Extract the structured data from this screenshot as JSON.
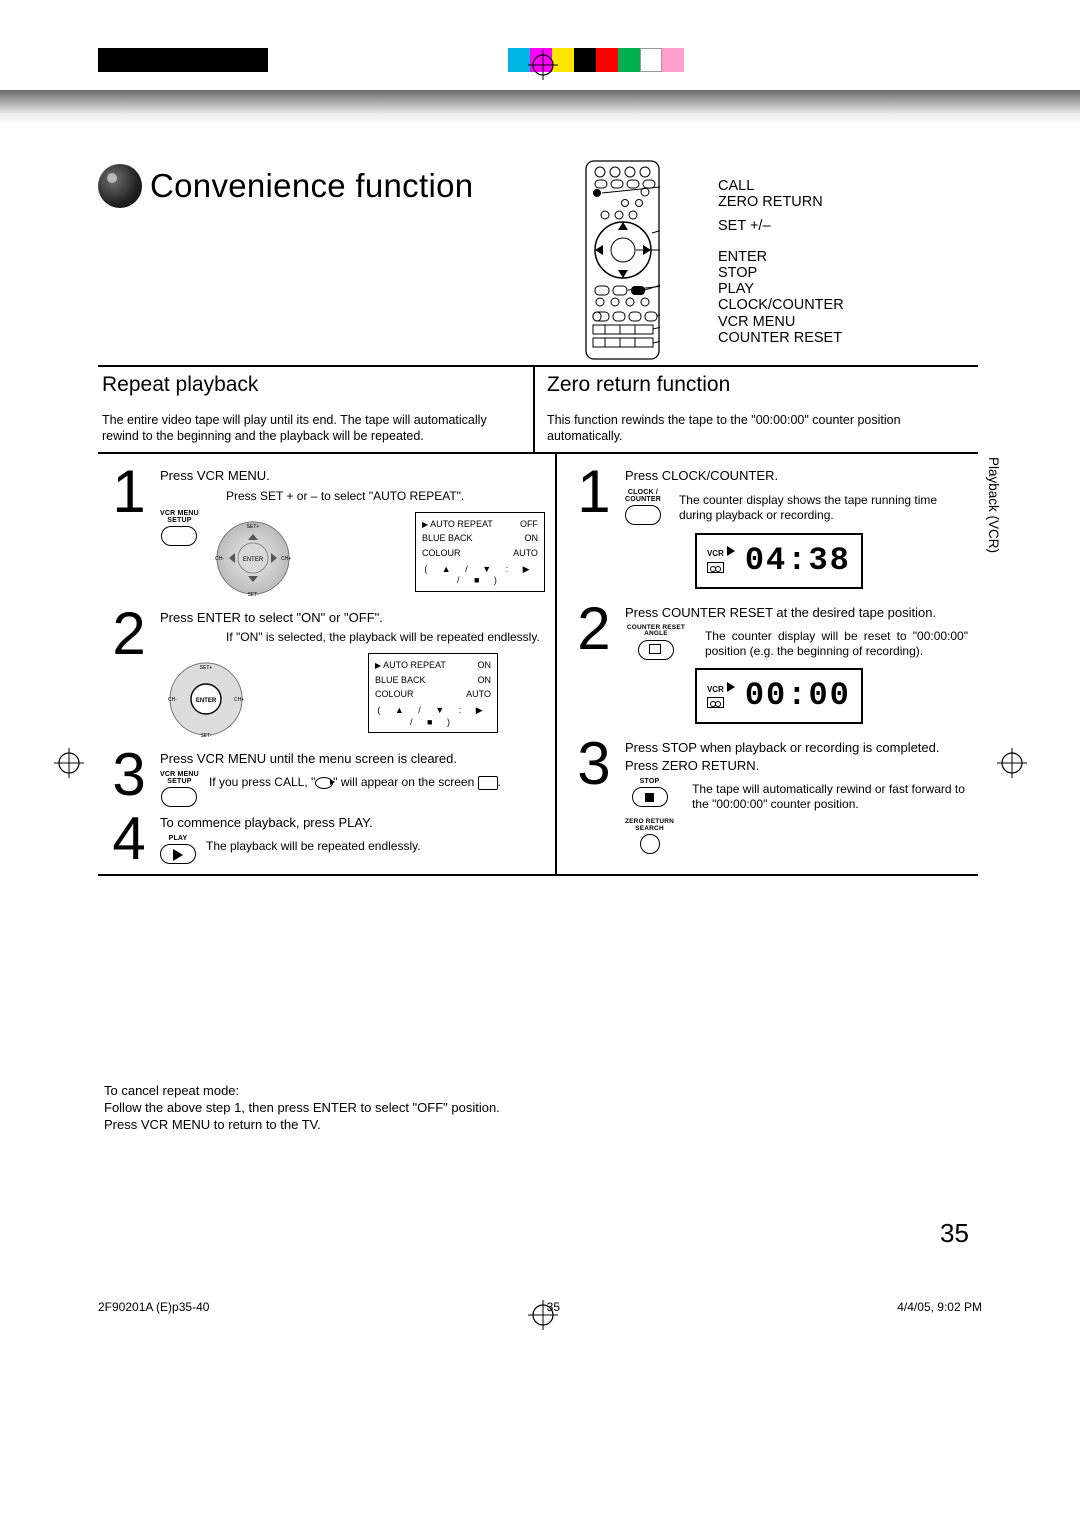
{
  "page": {
    "title": "Convenience function",
    "number": "35",
    "side_tab": "Playback (VCR)"
  },
  "colorbar": [
    "#00b5e2",
    "#ff00ff",
    "#ffe600",
    "#000000",
    "#ff0000",
    "#00b050",
    "#ffffff",
    "#ff9ecf"
  ],
  "remote_labels": [
    "CALL",
    "ZERO RETURN",
    "SET +/–",
    "ENTER",
    "STOP",
    "PLAY",
    "CLOCK/COUNTER",
    "VCR MENU",
    "COUNTER RESET"
  ],
  "left": {
    "heading": "Repeat playback",
    "intro": "The entire video tape will play until its end. The tape will automatically rewind to the beginning and the playback will be repeated.",
    "lcd_ctrls": "( ▲ / ▼ : ▶ / ■ )",
    "menu": {
      "rows": [
        {
          "label": "AUTO REPEAT",
          "value": "OFF",
          "sel": true
        },
        {
          "label": "BLUE BACK",
          "value": "ON"
        },
        {
          "label": "COLOUR",
          "value": "AUTO"
        }
      ]
    },
    "menu2": {
      "rows": [
        {
          "label": "AUTO REPEAT",
          "value": "ON",
          "sel": true
        },
        {
          "label": "BLUE BACK",
          "value": "ON"
        },
        {
          "label": "COLOUR",
          "value": "AUTO"
        }
      ]
    },
    "steps": [
      {
        "n": "1",
        "lead": "Press VCR MENU.",
        "expl": "Press SET + or – to select \"AUTO REPEAT\".",
        "btn": "VCR MENU SETUP"
      },
      {
        "n": "2",
        "lead": "Press ENTER to select \"ON\" or \"OFF\".",
        "expl": "If \"ON\" is selected, the playback will be repeated endlessly."
      },
      {
        "n": "3",
        "lead": "Press VCR MENU until the menu screen is cleared.",
        "expl": "If you press CALL, \"  \" will appear on the screen        .",
        "btn": "VCR MENU SETUP"
      },
      {
        "n": "4",
        "lead": "To commence playback, press PLAY.",
        "expl": "The playback will be repeated endlessly.",
        "btn": "PLAY"
      }
    ],
    "cancel": {
      "head": "To cancel repeat mode:",
      "body": "Follow the above step 1, then press ENTER to select \"OFF\" position. Press VCR MENU to return to the TV."
    }
  },
  "right": {
    "heading": "Zero return function",
    "intro": "This function rewinds the tape to the \"00:00:00\" counter position automatically.",
    "steps": [
      {
        "n": "1",
        "lead": "Press CLOCK/COUNTER.",
        "expl": "The counter display shows the tape running time during playback or recording.",
        "btn": "CLOCK / COUNTER",
        "lcd": "04:38"
      },
      {
        "n": "2",
        "lead": "Press COUNTER RESET at the desired tape position.",
        "expl": "The counter display will be reset to \"00:00:00\" position (e.g. the beginning of recording).",
        "btn": "COUNTER RESET ANGLE",
        "lcd": "00:00"
      },
      {
        "n": "3",
        "lead": "Press STOP when playback or recording is completed.",
        "lead2": "Press ZERO RETURN.",
        "expl": "The tape will automatically rewind or fast forward to the \"00:00:00\" counter position.",
        "btn1": "STOP",
        "btn2": "ZERO RETURN SEARCH"
      }
    ]
  },
  "lcd": {
    "tag": "VCR"
  },
  "footer": {
    "doc": "2F90201A (E)p35-40",
    "pg": "35",
    "stamp": "4/4/05, 9:02 PM"
  }
}
